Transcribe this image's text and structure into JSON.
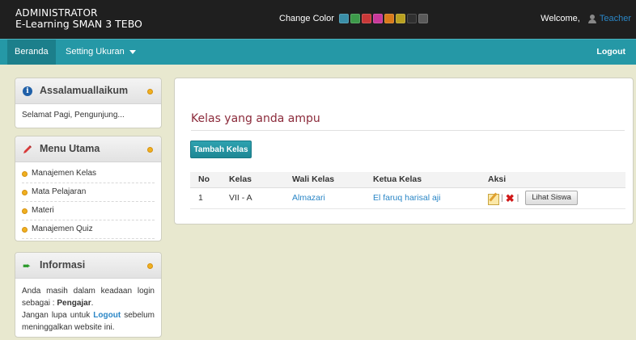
{
  "header": {
    "title_line1": "ADMINISTRATOR",
    "title_line2": "E-Learning SMAN 3 TEBO",
    "change_color_label": "Change Color",
    "swatches": [
      "#3a8fa8",
      "#3d9a4a",
      "#c83838",
      "#c8389a",
      "#d87a1a",
      "#b8a020",
      "#303030",
      "#5a5a5a"
    ],
    "welcome_label": "Welcome,",
    "user_name": "Teacher"
  },
  "nav": {
    "home": "Beranda",
    "setting": "Setting Ukuran",
    "logout": "Logout"
  },
  "sidebar": {
    "greeting": {
      "title": "Assalamuallaikum",
      "text": "Selamat Pagi, Pengunjung..."
    },
    "menu": {
      "title": "Menu Utama",
      "items": [
        {
          "label": "Manajemen Kelas"
        },
        {
          "label": "Mata Pelajaran"
        },
        {
          "label": "Materi"
        },
        {
          "label": "Manajemen Quiz"
        }
      ]
    },
    "info": {
      "title": "Informasi",
      "line1": "Anda masih dalam keadaan login sebagai :",
      "role": "Pengajar",
      "line2_pre": "Jangan lupa untuk",
      "logout_word": "Logout",
      "line2_post": "sebelum meninggalkan website ini."
    }
  },
  "main": {
    "title": "Kelas yang anda ampu",
    "add_button": "Tambah Kelas",
    "table": {
      "headers": [
        "No",
        "Kelas",
        "Wali Kelas",
        "Ketua Kelas",
        "Aksi"
      ],
      "rows": [
        {
          "no": "1",
          "kelas": "VII - A",
          "wali": "Almazari",
          "ketua": "El faruq harisal aji",
          "view_button": "Lihat Siswa"
        }
      ]
    }
  },
  "colors": {
    "topbar": "#1f1f1f",
    "navbar": "#2598a6",
    "accent_title": "#8b2a3a",
    "link": "#2a86c6"
  }
}
